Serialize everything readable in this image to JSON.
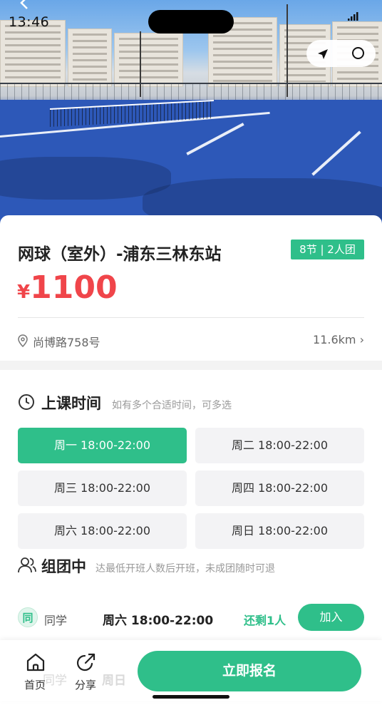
{
  "status_bar": {
    "time": "13:46"
  },
  "course": {
    "title": "网球（室外）-浦东三林东站",
    "badge": "8节 | 2人团",
    "currency": "¥",
    "price": "1100",
    "address": "尚博路758号",
    "distance": "11.6km ›"
  },
  "schedule": {
    "title": "上课时间",
    "hint": "如有多个合适时间，可多选",
    "slots": [
      {
        "label": "周一 18:00-22:00",
        "selected": true
      },
      {
        "label": "周二 18:00-22:00",
        "selected": false
      },
      {
        "label": "周三 18:00-22:00",
        "selected": false
      },
      {
        "label": "周四 18:00-22:00",
        "selected": false
      },
      {
        "label": "周六 18:00-22:00",
        "selected": false
      },
      {
        "label": "周日 18:00-22:00",
        "selected": false
      }
    ]
  },
  "groups": {
    "title": "组团中",
    "hint": "达最低开班人数后开班，未成团随时可退",
    "rows": [
      {
        "avatar": "同",
        "name": "同学",
        "time": "周六 18:00-22:00",
        "remaining": "还剩1人",
        "action": "加入"
      }
    ],
    "peek_name": "同学",
    "peek_time": "周日"
  },
  "bottom_bar": {
    "home_label": "首页",
    "share_label": "分享",
    "cta_label": "立即报名"
  },
  "colors": {
    "accent": "#2fbf8a",
    "price": "#f0454a"
  },
  "icons": [
    "back-icon",
    "signal-icon",
    "navigate-icon",
    "record-icon",
    "location-pin-icon",
    "clock-icon",
    "people-icon",
    "home-icon",
    "share-icon"
  ]
}
